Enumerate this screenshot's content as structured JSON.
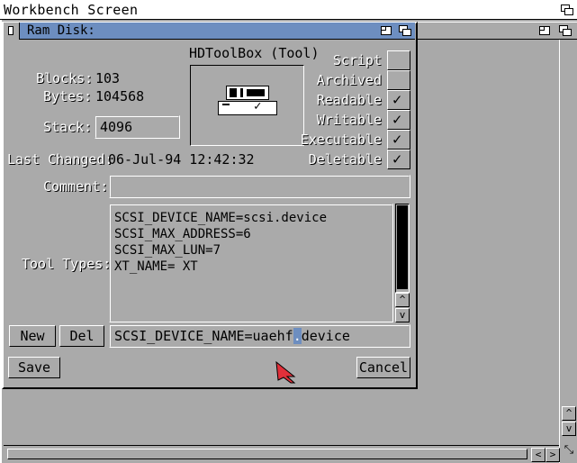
{
  "screen": {
    "title": "Workbench Screen"
  },
  "window": {
    "title": "Ram Disk:"
  },
  "tool": {
    "name": "HDToolBox (Tool)"
  },
  "info": {
    "blocks_label": "Blocks:",
    "blocks_value": "103",
    "bytes_label": "Bytes:",
    "bytes_value": "104568",
    "stack_label": "Stack:",
    "stack_value": "4096",
    "changed_label": "Last Changed:",
    "changed_value": "06-Jul-94 12:42:32",
    "comment_label": "Comment:",
    "comment_value": ""
  },
  "protection": [
    {
      "label": "Script",
      "checked": false
    },
    {
      "label": "Archived",
      "checked": false
    },
    {
      "label": "Readable",
      "checked": true
    },
    {
      "label": "Writable",
      "checked": true
    },
    {
      "label": "Executable",
      "checked": true
    },
    {
      "label": "Deletable",
      "checked": true
    }
  ],
  "check_glyph": "✓",
  "tooltypes": {
    "label": "Tool Types:",
    "lines": [
      "SCSI_DEVICE_NAME=scsi.device",
      "SCSI_MAX_ADDRESS=6",
      "SCSI_MAX_LUN=7",
      "XT_NAME=  XT"
    ],
    "edit_before": "SCSI_DEVICE_NAME=uaehf",
    "edit_cursor": ".",
    "edit_after": "device"
  },
  "buttons": {
    "new": "New",
    "del": "Del",
    "save": "Save",
    "cancel": "Cancel"
  },
  "arrows": {
    "up": "^",
    "down": "v",
    "left": "<",
    "right": ">"
  },
  "colors": {
    "titlebar": "#6d8ec0",
    "background": "#aaaaaa",
    "pointer": "#e0303a"
  }
}
